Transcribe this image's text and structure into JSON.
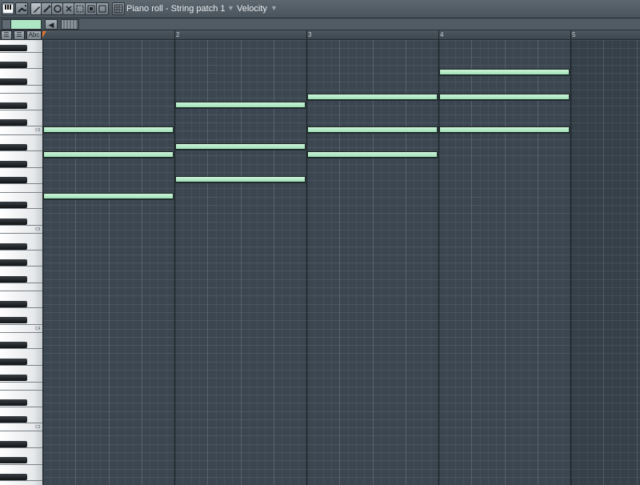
{
  "toolbar": {
    "title": "Piano roll - String patch 1",
    "target": "Velocity",
    "icons": [
      "piano-icon",
      "wrench-icon",
      "pencil-icon",
      "paint-icon",
      "delete-icon",
      "mute-icon",
      "select-icon",
      "zoom-icon",
      "playback-icon",
      "snap-icon"
    ]
  },
  "corner": {
    "btn1": "☰",
    "btn2": "☰",
    "btn3": "Abc"
  },
  "ruler": {
    "bars": [
      "2",
      "3",
      "4",
      "5"
    ]
  },
  "keyboard": {
    "labels": [
      "C6",
      "C5",
      "C4",
      "C3"
    ]
  },
  "notes": [
    {
      "bar": 1,
      "length": 1,
      "row": 19
    },
    {
      "bar": 1,
      "length": 1,
      "row": 14
    },
    {
      "bar": 1,
      "length": 1,
      "row": 11
    },
    {
      "bar": 2,
      "length": 1,
      "row": 17
    },
    {
      "bar": 2,
      "length": 1,
      "row": 13
    },
    {
      "bar": 2,
      "length": 1,
      "row": 8
    },
    {
      "bar": 3,
      "length": 1,
      "row": 14
    },
    {
      "bar": 3,
      "length": 1,
      "row": 11
    },
    {
      "bar": 3,
      "length": 1,
      "row": 7
    },
    {
      "bar": 4,
      "length": 1,
      "row": 11
    },
    {
      "bar": 4,
      "length": 1,
      "row": 7
    },
    {
      "bar": 4,
      "length": 1,
      "row": 4
    }
  ],
  "colors": {
    "note": "#aee7c5",
    "grid_bg": "#3b4650",
    "bar_line": "#1e252b",
    "beat_line": "#56626c"
  }
}
